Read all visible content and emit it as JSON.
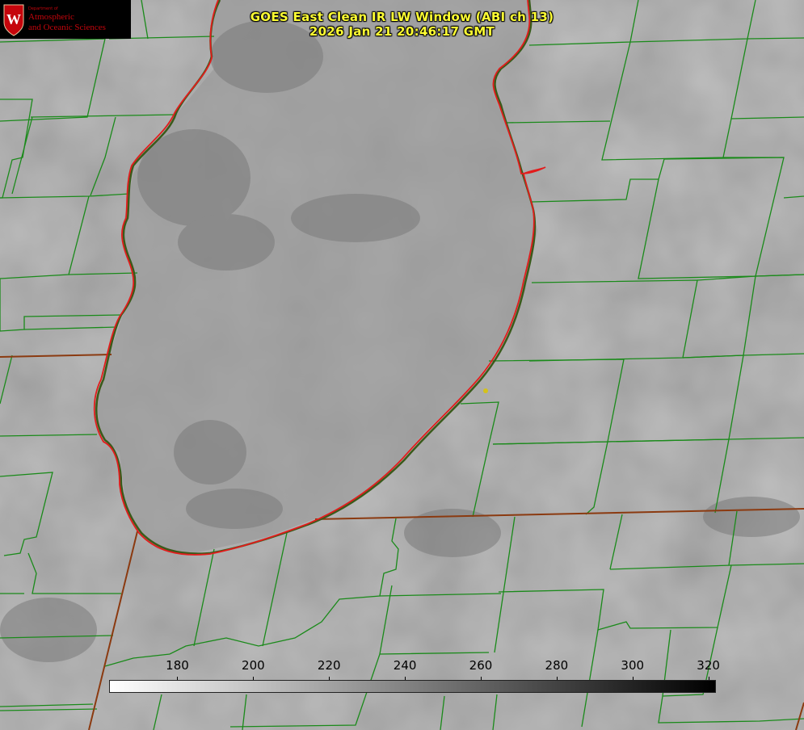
{
  "title": {
    "line1": "GOES East Clean IR LW Window (ABI ch 13)",
    "line2": "2026 Jan 21 20:46:17 GMT"
  },
  "logo": {
    "department": "Department of",
    "line1": "Atmospheric",
    "line2": "and Oceanic Sciences",
    "emblem_letter": "W"
  },
  "colorbar": {
    "ticks": [
      "180",
      "200",
      "220",
      "240",
      "260",
      "280",
      "300",
      "320"
    ],
    "min": 162,
    "max": 322,
    "gradient": [
      "#ffffff",
      "#000000"
    ]
  },
  "colors": {
    "lake_outline": "#e21c1c",
    "county_lines": "#1a8a1a",
    "state_lines": "#8b4513",
    "title_text": "#ffff33",
    "marker": "#d4c21a"
  }
}
